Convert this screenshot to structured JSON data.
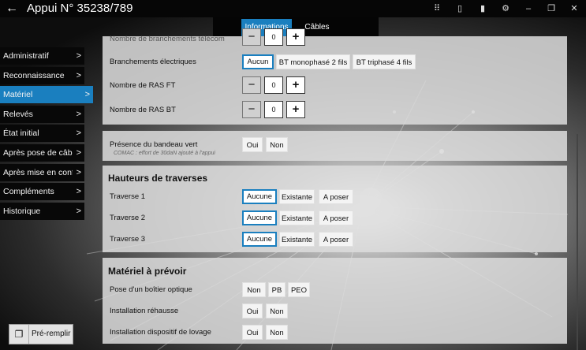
{
  "window": {
    "title": "Appui N° 35238/789"
  },
  "tabs": [
    {
      "label": "Informations"
    },
    {
      "label": "Câbles"
    }
  ],
  "sidebar": {
    "items": [
      {
        "label": "Administratif"
      },
      {
        "label": "Reconnaissance"
      },
      {
        "label": "Matériel"
      },
      {
        "label": "Relevés"
      },
      {
        "label": "État initial"
      },
      {
        "label": "Après pose de câble"
      },
      {
        "label": "Après mise en confor"
      },
      {
        "label": "Compléments"
      },
      {
        "label": "Historique"
      }
    ],
    "chevron": ">",
    "prefill_label": "Pré-remplir"
  },
  "panel1": {
    "partial_label": "Nombre de branchements télécom",
    "partial_value": "0",
    "branchements_label": "Branchements électriques",
    "branchements_options": [
      "Aucun",
      "BT monophasé 2 fils",
      "BT triphasé 4 fils"
    ],
    "ras_ft_label": "Nombre de RAS FT",
    "ras_ft_value": "0",
    "ras_bt_label": "Nombre de RAS BT",
    "ras_bt_value": "0",
    "minus": "−",
    "plus": "+"
  },
  "panel2": {
    "label": "Présence du bandeau vert",
    "note": "COMAC : effort de 30daN ajouté à l'appui",
    "options": [
      "Oui",
      "Non"
    ]
  },
  "panel3": {
    "title": "Hauteurs de traverses",
    "rows": [
      {
        "label": "Traverse 1"
      },
      {
        "label": "Traverse 2"
      },
      {
        "label": "Traverse 3"
      }
    ],
    "options": [
      "Aucune",
      "Existante",
      "A poser"
    ]
  },
  "panel4": {
    "title": "Matériel à prévoir",
    "pose_label": "Pose d'un boîtier optique",
    "pose_options": [
      "Non",
      "PB",
      "PEO"
    ],
    "rehausse_label": "Installation réhausse",
    "rehausse_options": [
      "Oui",
      "Non"
    ],
    "lovage_label": "Installation dispositif de lovage",
    "lovage_options": [
      "Oui",
      "Non"
    ]
  },
  "colors": {
    "accent": "#1a7fbf",
    "titlebar": "#060606",
    "sidebar": "#080808"
  }
}
